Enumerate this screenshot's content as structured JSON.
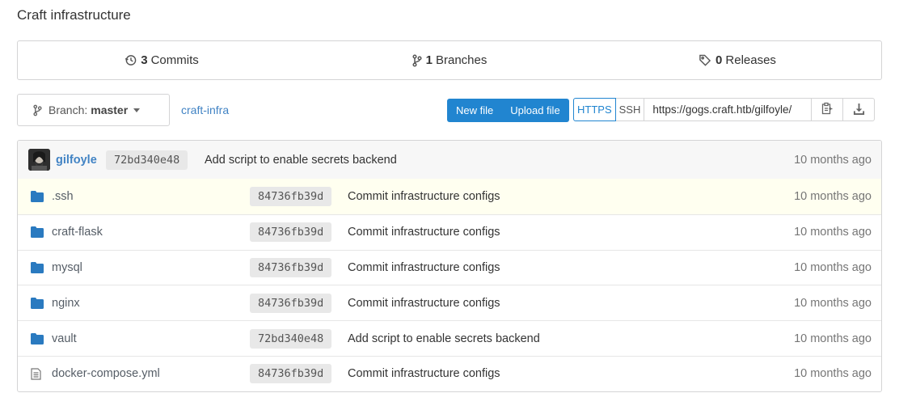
{
  "repo": {
    "description": "Craft infrastructure"
  },
  "stats": {
    "commits": {
      "count": "3",
      "label": "Commits",
      "icon": "history-icon"
    },
    "branches": {
      "count": "1",
      "label": "Branches",
      "icon": "git-branch-icon"
    },
    "releases": {
      "count": "0",
      "label": "Releases",
      "icon": "tag-icon"
    }
  },
  "toolbar": {
    "branch_prefix": "Branch:",
    "branch_name": "master",
    "path": "craft-infra",
    "new_file": "New file",
    "upload_file": "Upload file",
    "clone_https": "HTTPS",
    "clone_ssh": "SSH",
    "clone_url": "https://gogs.craft.htb/gilfoyle/",
    "accent_color": "#2185d0"
  },
  "latest_commit": {
    "author": "gilfoyle",
    "sha": "72bd340e48",
    "message": "Add script to enable secrets backend",
    "age": "10 months ago"
  },
  "files": [
    {
      "name": ".ssh",
      "type": "folder",
      "sha": "84736fb39d",
      "message": "Commit infrastructure configs",
      "age": "10 months ago"
    },
    {
      "name": "craft-flask",
      "type": "folder",
      "sha": "84736fb39d",
      "message": "Commit infrastructure configs",
      "age": "10 months ago"
    },
    {
      "name": "mysql",
      "type": "folder",
      "sha": "84736fb39d",
      "message": "Commit infrastructure configs",
      "age": "10 months ago"
    },
    {
      "name": "nginx",
      "type": "folder",
      "sha": "84736fb39d",
      "message": "Commit infrastructure configs",
      "age": "10 months ago"
    },
    {
      "name": "vault",
      "type": "folder",
      "sha": "72bd340e48",
      "message": "Add script to enable secrets backend",
      "age": "10 months ago"
    },
    {
      "name": "docker-compose.yml",
      "type": "file",
      "sha": "84736fb39d",
      "message": "Commit infrastructure configs",
      "age": "10 months ago"
    }
  ]
}
